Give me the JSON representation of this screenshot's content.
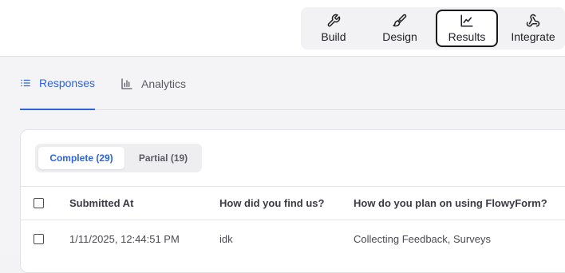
{
  "toolbar": {
    "modes": [
      {
        "label": "Build",
        "icon": "wrench-icon",
        "active": false
      },
      {
        "label": "Design",
        "icon": "paintbrush-icon",
        "active": false
      },
      {
        "label": "Results",
        "icon": "line-chart-icon",
        "active": true
      },
      {
        "label": "Integrate",
        "icon": "webhook-icon",
        "active": false
      }
    ]
  },
  "tabs": [
    {
      "label": "Responses",
      "icon": "list-icon",
      "active": true
    },
    {
      "label": "Analytics",
      "icon": "bar-chart-icon",
      "active": false
    }
  ],
  "filter": {
    "complete_label": "Complete (29)",
    "partial_label": "Partial (19)"
  },
  "table": {
    "columns": [
      "Submitted At",
      "How did you find us?",
      "How do you plan on using FlowyForm?"
    ],
    "rows": [
      [
        "1/11/2025, 12:44:51 PM",
        "idk",
        "Collecting Feedback, Surveys"
      ]
    ]
  },
  "colors": {
    "accent": "#2f63d8",
    "active_border": "#17171c"
  }
}
